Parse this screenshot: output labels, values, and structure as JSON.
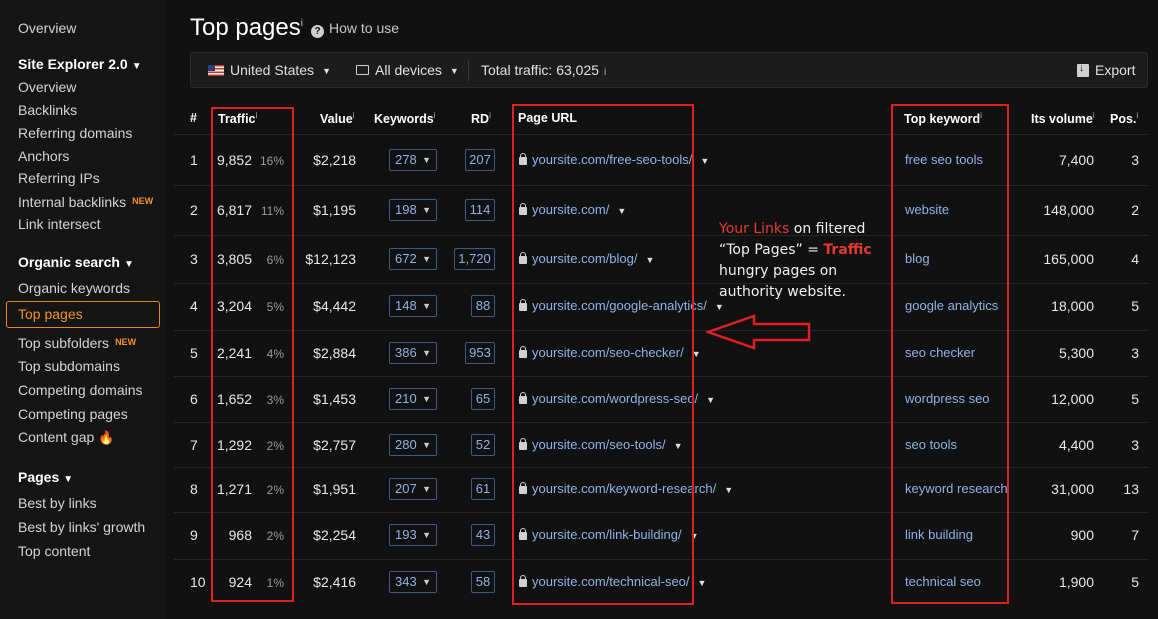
{
  "sidebar": {
    "overview": "Overview",
    "site_explorer": "Site Explorer 2.0",
    "se_items": [
      "Overview",
      "Backlinks",
      "Referring domains",
      "Anchors",
      "Referring IPs",
      "Internal backlinks",
      "Link intersect"
    ],
    "organic_search": "Organic search",
    "os_items": [
      "Organic keywords",
      "Top pages",
      "Top subfolders",
      "Top subdomains",
      "Competing domains",
      "Competing pages",
      "Content gap"
    ],
    "pages": "Pages",
    "pages_items": [
      "Best by links",
      "Best by links' growth",
      "Top content"
    ],
    "new_badge": "NEW",
    "active_item": "Top pages"
  },
  "header": {
    "title": "Top pages",
    "title_sup": "i",
    "how_to_use": "How to use"
  },
  "toolbar": {
    "country": "United States",
    "device": "All devices",
    "total_traffic": "Total traffic: 63,025",
    "export": "Export"
  },
  "table": {
    "columns": {
      "index": "#",
      "traffic": "Traffic",
      "value": "Value",
      "keywords": "Keywords",
      "rd": "RD",
      "page_url": "Page URL",
      "top_keyword": "Top keyword",
      "volume": "Its volume",
      "pos": "Pos."
    },
    "rows": [
      {
        "n": "1",
        "traffic": "9,852",
        "pct": "16%",
        "value": "$2,218",
        "keywords": "278",
        "rd": "207",
        "url": "yoursite.com/free-seo-tools/",
        "top_keyword": "free seo tools",
        "volume": "7,400",
        "pos": "3"
      },
      {
        "n": "2",
        "traffic": "6,817",
        "pct": "11%",
        "value": "$1,195",
        "keywords": "198",
        "rd": "114",
        "url": "yoursite.com/",
        "top_keyword": "website",
        "volume": "148,000",
        "pos": "2"
      },
      {
        "n": "3",
        "traffic": "3,805",
        "pct": "6%",
        "value": "$12,123",
        "keywords": "672",
        "rd": "1,720",
        "url": "yoursite.com/blog/",
        "top_keyword": "blog",
        "volume": "165,000",
        "pos": "4"
      },
      {
        "n": "4",
        "traffic": "3,204",
        "pct": "5%",
        "value": "$4,442",
        "keywords": "148",
        "rd": "88",
        "url": "yoursite.com/google-analytics/",
        "top_keyword": "google analytics",
        "volume": "18,000",
        "pos": "5"
      },
      {
        "n": "5",
        "traffic": "2,241",
        "pct": "4%",
        "value": "$2,884",
        "keywords": "386",
        "rd": "953",
        "url": "yoursite.com/seo-checker/",
        "top_keyword": "seo checker",
        "volume": "5,300",
        "pos": "3"
      },
      {
        "n": "6",
        "traffic": "1,652",
        "pct": "3%",
        "value": "$1,453",
        "keywords": "210",
        "rd": "65",
        "url": "yoursite.com/wordpress-seo/",
        "top_keyword": "wordpress seo",
        "volume": "12,000",
        "pos": "5"
      },
      {
        "n": "7",
        "traffic": "1,292",
        "pct": "2%",
        "value": "$2,757",
        "keywords": "280",
        "rd": "52",
        "url": "yoursite.com/seo-tools/",
        "top_keyword": "seo tools",
        "volume": "4,400",
        "pos": "3"
      },
      {
        "n": "8",
        "traffic": "1,271",
        "pct": "2%",
        "value": "$1,951",
        "keywords": "207",
        "rd": "61",
        "url": "yoursite.com/keyword-research/",
        "top_keyword": "keyword research",
        "volume": "31,000",
        "pos": "13"
      },
      {
        "n": "9",
        "traffic": "968",
        "pct": "2%",
        "value": "$2,254",
        "keywords": "193",
        "rd": "43",
        "url": "yoursite.com/link-building/",
        "top_keyword": "link building",
        "volume": "900",
        "pos": "7"
      },
      {
        "n": "10",
        "traffic": "924",
        "pct": "1%",
        "value": "$2,416",
        "keywords": "343",
        "rd": "58",
        "url": "yoursite.com/technical-seo/",
        "top_keyword": "technical seo",
        "volume": "1,900",
        "pos": "5"
      }
    ]
  },
  "annotation": {
    "part1": "Your Links",
    "part2": " on filtered",
    "part3": "“Top Pages” = ",
    "part4": "Traffic",
    "part5": "hungry pages on",
    "part6": "authority website."
  },
  "colors": {
    "accent": "#f2912a",
    "link": "#8fb3e8",
    "highlight": "#e02020"
  }
}
